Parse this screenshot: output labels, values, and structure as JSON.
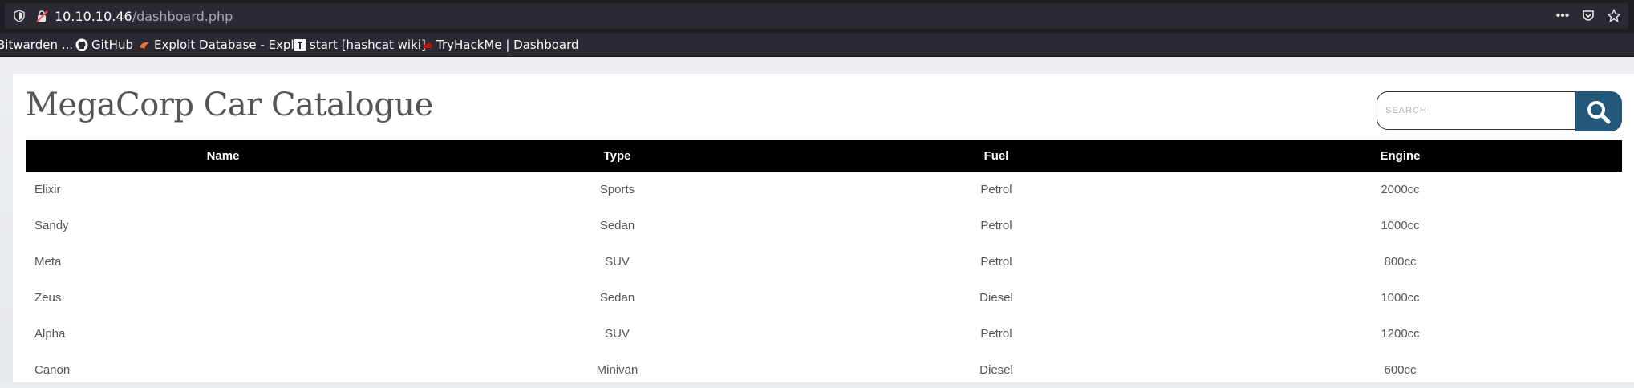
{
  "browser": {
    "url_host": "10.10.10.46",
    "url_path": "/dashboard.php",
    "bookmarks": [
      {
        "label": "Bitwarden ...",
        "icon": "bitwarden-icon"
      },
      {
        "label": "GitHub",
        "icon": "github-icon"
      },
      {
        "label": "Exploit Database - Expl...",
        "icon": "exploit-db-icon"
      },
      {
        "label": "start [hashcat wiki]",
        "icon": "hashcat-icon"
      },
      {
        "label": "TryHackMe | Dashboard",
        "icon": "tryhackme-icon"
      }
    ],
    "icons": [
      "shield-icon",
      "insecure-lock-icon",
      "more-icon",
      "pocket-icon",
      "star-icon"
    ]
  },
  "page": {
    "title": "MegaCorp Car Catalogue",
    "search_placeholder": "SEARCH",
    "accent_color": "#23587a"
  },
  "table": {
    "columns": [
      "Name",
      "Type",
      "Fuel",
      "Engine"
    ],
    "rows": [
      [
        "Elixir",
        "Sports",
        "Petrol",
        "2000cc"
      ],
      [
        "Sandy",
        "Sedan",
        "Petrol",
        "1000cc"
      ],
      [
        "Meta",
        "SUV",
        "Petrol",
        "800cc"
      ],
      [
        "Zeus",
        "Sedan",
        "Diesel",
        "1000cc"
      ],
      [
        "Alpha",
        "SUV",
        "Petrol",
        "1200cc"
      ],
      [
        "Canon",
        "Minivan",
        "Diesel",
        "600cc"
      ]
    ]
  }
}
